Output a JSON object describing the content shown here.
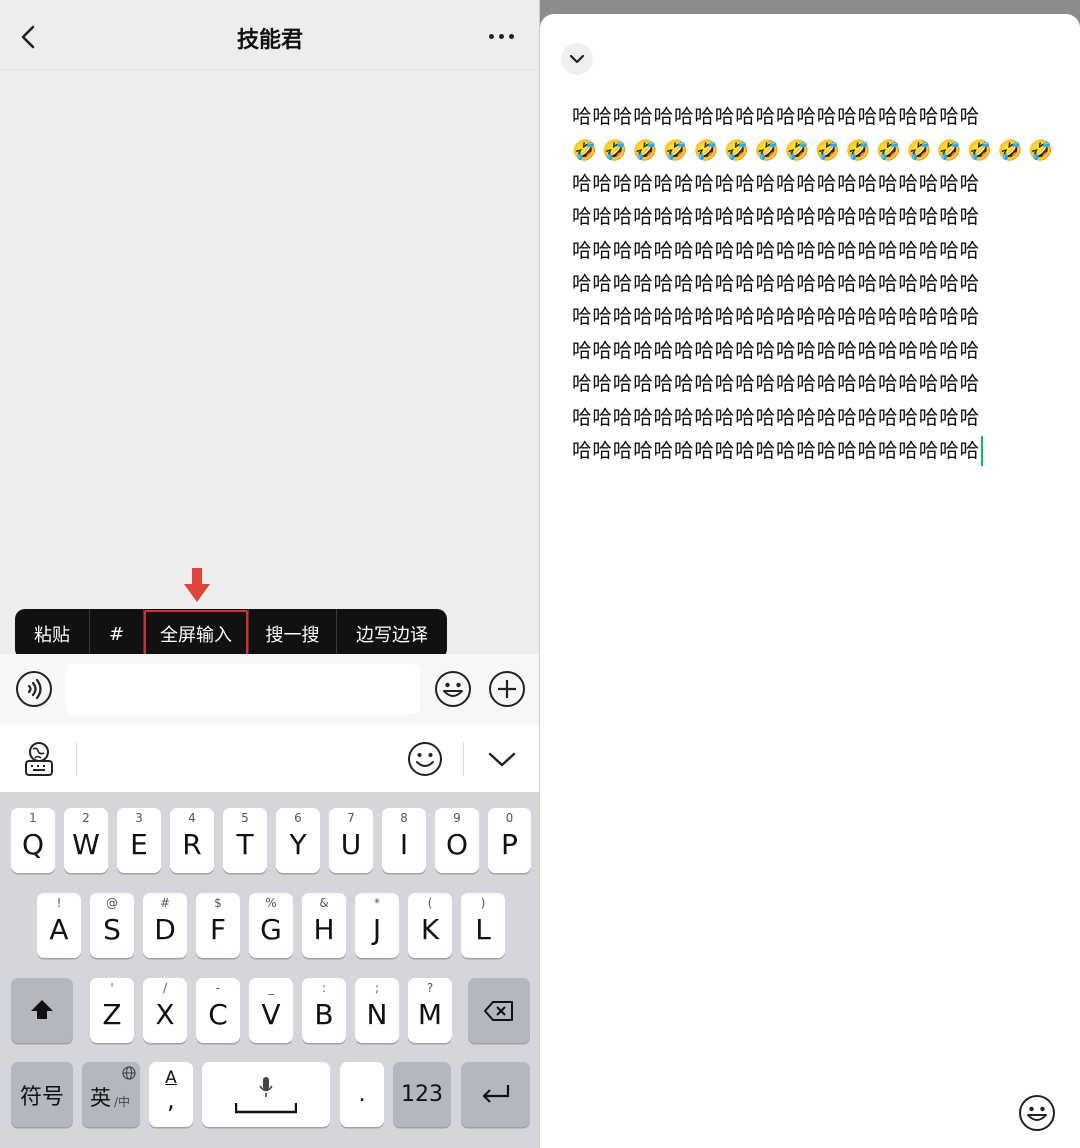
{
  "chat": {
    "title": "技能君"
  },
  "context_menu": {
    "items": [
      "粘贴",
      "#",
      "全屏输入",
      "搜一搜",
      "边写边译"
    ],
    "highlight_color": "#e02a2a"
  },
  "input": {
    "value": "",
    "placeholder": ""
  },
  "keyboard": {
    "row1": [
      {
        "main": "Q",
        "sub": "1"
      },
      {
        "main": "W",
        "sub": "2"
      },
      {
        "main": "E",
        "sub": "3"
      },
      {
        "main": "R",
        "sub": "4"
      },
      {
        "main": "T",
        "sub": "5"
      },
      {
        "main": "Y",
        "sub": "6"
      },
      {
        "main": "U",
        "sub": "7"
      },
      {
        "main": "I",
        "sub": "8"
      },
      {
        "main": "O",
        "sub": "9"
      },
      {
        "main": "P",
        "sub": "0"
      }
    ],
    "row2": [
      {
        "main": "A",
        "sub": "!"
      },
      {
        "main": "S",
        "sub": "@"
      },
      {
        "main": "D",
        "sub": "#"
      },
      {
        "main": "F",
        "sub": "$"
      },
      {
        "main": "G",
        "sub": "%"
      },
      {
        "main": "H",
        "sub": "&"
      },
      {
        "main": "J",
        "sub": "*"
      },
      {
        "main": "K",
        "sub": "("
      },
      {
        "main": "L",
        "sub": ")"
      }
    ],
    "row3": [
      {
        "main": "Z",
        "sub": "'"
      },
      {
        "main": "X",
        "sub": "/"
      },
      {
        "main": "C",
        "sub": "-"
      },
      {
        "main": "V",
        "sub": "_"
      },
      {
        "main": "B",
        "sub": ":"
      },
      {
        "main": "N",
        "sub": ";"
      },
      {
        "main": "M",
        "sub": "?"
      }
    ],
    "symbols_label": "符号",
    "lang_label": "英",
    "lang_sub": "/中",
    "punct_top": "A",
    "punct_bottom": ",",
    "period_label": ".",
    "num_label": "123",
    "accent_color": "#07c160"
  },
  "fullscreen_editor": {
    "lines": [
      "哈哈哈哈哈哈哈哈哈哈哈哈哈哈哈哈哈哈哈哈",
      "🤣🤣🤣🤣🤣🤣🤣🤣🤣🤣🤣🤣🤣🤣🤣🤣",
      "哈哈哈哈哈哈哈哈哈哈哈哈哈哈哈哈哈哈哈哈",
      "哈哈哈哈哈哈哈哈哈哈哈哈哈哈哈哈哈哈哈哈",
      "哈哈哈哈哈哈哈哈哈哈哈哈哈哈哈哈哈哈哈哈",
      "哈哈哈哈哈哈哈哈哈哈哈哈哈哈哈哈哈哈哈哈",
      "哈哈哈哈哈哈哈哈哈哈哈哈哈哈哈哈哈哈哈哈",
      "哈哈哈哈哈哈哈哈哈哈哈哈哈哈哈哈哈哈哈哈",
      "哈哈哈哈哈哈哈哈哈哈哈哈哈哈哈哈哈哈哈哈",
      "哈哈哈哈哈哈哈哈哈哈哈哈哈哈哈哈哈哈哈哈",
      "哈哈哈哈哈哈哈哈哈哈哈哈哈哈哈哈哈哈哈哈"
    ],
    "caret_color": "#07c160"
  }
}
